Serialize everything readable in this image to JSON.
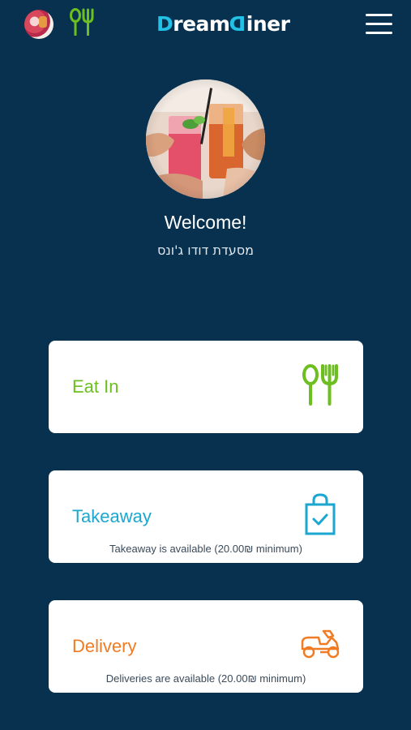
{
  "header": {
    "brand_first": "D",
    "brand_middle": "ream",
    "brand_mid2": "D",
    "brand_end": "iner",
    "avatar_icon": "restaurant-avatar",
    "utensils_icon": "utensils-icon",
    "menu_icon": "hamburger-menu-icon"
  },
  "welcome": {
    "title": "Welcome!",
    "restaurant_name": "מסעדת דודו ג'ונס"
  },
  "options": {
    "eat_in": {
      "label": "Eat In",
      "color": "#6cbf1e",
      "icon": "utensils-icon"
    },
    "takeaway": {
      "label": "Takeaway",
      "subtitle": "Takeaway is available (20.00₪ minimum)",
      "color": "#1ba7d0",
      "icon": "shopping-bag-check-icon"
    },
    "delivery": {
      "label": "Delivery",
      "subtitle": "Deliveries are available (20.00₪ minimum)",
      "color": "#f07b22",
      "icon": "scooter-icon"
    }
  },
  "colors": {
    "background": "#07314f",
    "card": "#ffffff",
    "brand_accent": "#22c1e6"
  }
}
